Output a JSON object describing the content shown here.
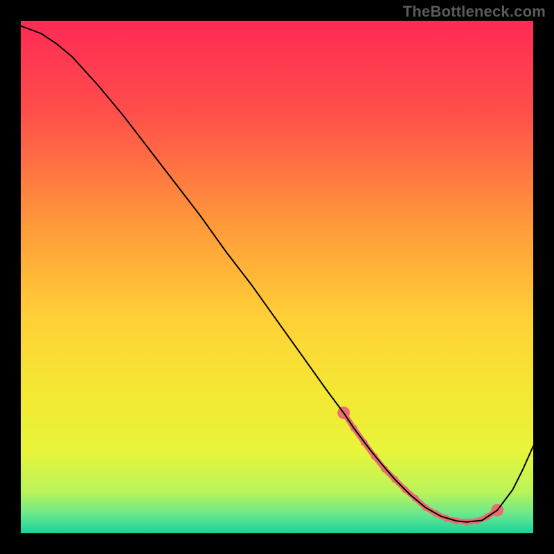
{
  "watermark": "TheBottleneck.com",
  "chart_data": {
    "type": "line",
    "title": "",
    "xlabel": "",
    "ylabel": "",
    "xlim": [
      0,
      100
    ],
    "ylim": [
      0,
      100
    ],
    "grid": false,
    "legend": false,
    "background_gradient_stops": [
      {
        "offset": 0.0,
        "color": "#ff2a55"
      },
      {
        "offset": 0.18,
        "color": "#ff4f4a"
      },
      {
        "offset": 0.4,
        "color": "#ff9a3a"
      },
      {
        "offset": 0.58,
        "color": "#ffd037"
      },
      {
        "offset": 0.72,
        "color": "#f4e733"
      },
      {
        "offset": 0.84,
        "color": "#e8f53a"
      },
      {
        "offset": 0.92,
        "color": "#b9f45a"
      },
      {
        "offset": 0.965,
        "color": "#64e78e"
      },
      {
        "offset": 1.0,
        "color": "#19d39a"
      }
    ],
    "series": [
      {
        "name": "curve",
        "color": "#000000",
        "width": 2,
        "x": [
          0,
          4,
          7,
          10,
          15,
          20,
          25,
          30,
          35,
          40,
          45,
          50,
          55,
          60,
          63,
          65,
          68,
          70,
          73,
          76,
          79,
          82,
          85,
          87,
          90,
          93,
          96,
          98,
          100
        ],
        "y": [
          99,
          97.5,
          95.5,
          93,
          87.5,
          81.5,
          75,
          68.5,
          62,
          55,
          48.5,
          41.5,
          34.5,
          27.5,
          23.5,
          20.5,
          16.5,
          14,
          10.5,
          7.5,
          5,
          3.3,
          2.4,
          2.2,
          2.5,
          4.5,
          8.5,
          12.5,
          17
        ]
      }
    ],
    "marker_segment": {
      "name": "bottom-band",
      "color": "#e96f6f",
      "radius": 5,
      "cap_radius": 9,
      "x": [
        63,
        65,
        67,
        69,
        71,
        73,
        75,
        77,
        79,
        81,
        83,
        85,
        87,
        89,
        91,
        93
      ],
      "y": [
        23.5,
        20.5,
        17.7,
        15,
        12.5,
        10.5,
        8.5,
        6.8,
        5,
        3.8,
        2.9,
        2.4,
        2.2,
        2.35,
        3.2,
        4.5
      ]
    }
  }
}
